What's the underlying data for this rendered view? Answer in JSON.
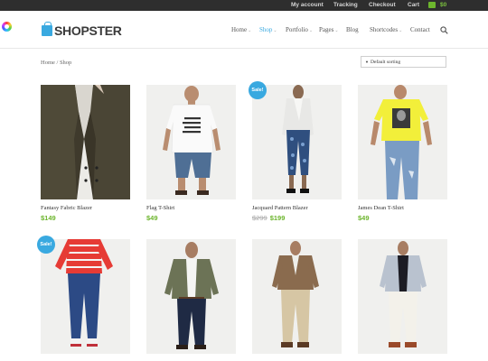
{
  "topbar": {
    "links": [
      "My account",
      "Tracking",
      "Checkout",
      "Cart"
    ],
    "cart_total": "$0",
    "cart_icon": "cart-icon"
  },
  "header": {
    "logo": "SHOPSTER",
    "nav": [
      "Home",
      "Shop",
      "Portfolio",
      "Pages",
      "Blog",
      "Shortcodes",
      "Contact"
    ],
    "active_nav": "Shop",
    "search_icon": "search-icon",
    "accent": "#39a9e0"
  },
  "breadcrumb": "Home / Shop",
  "sorting": {
    "selected": "Default sorting"
  },
  "products": [
    {
      "name": "Fantasy Fabric Blazer",
      "price": "$149",
      "old_price": "",
      "sale": false
    },
    {
      "name": "Flag T-Shirt",
      "price": "$49",
      "old_price": "",
      "sale": false
    },
    {
      "name": "Jacquard Pattern Blazer",
      "price": "$199",
      "old_price": "$299",
      "sale": true,
      "badge": "Sale!"
    },
    {
      "name": "James Dean T-Shirt",
      "price": "$49",
      "old_price": "",
      "sale": false
    },
    {
      "name": "",
      "price": "",
      "old_price": "",
      "sale": true,
      "badge": "Sale!"
    },
    {
      "name": "",
      "price": "",
      "old_price": "",
      "sale": false
    },
    {
      "name": "",
      "price": "",
      "old_price": "",
      "sale": false
    },
    {
      "name": "",
      "price": "",
      "old_price": "",
      "sale": false
    }
  ],
  "colors": {
    "price": "#6cb52d",
    "topbar": "#2e2e2e",
    "badge": "#39a9e0"
  }
}
